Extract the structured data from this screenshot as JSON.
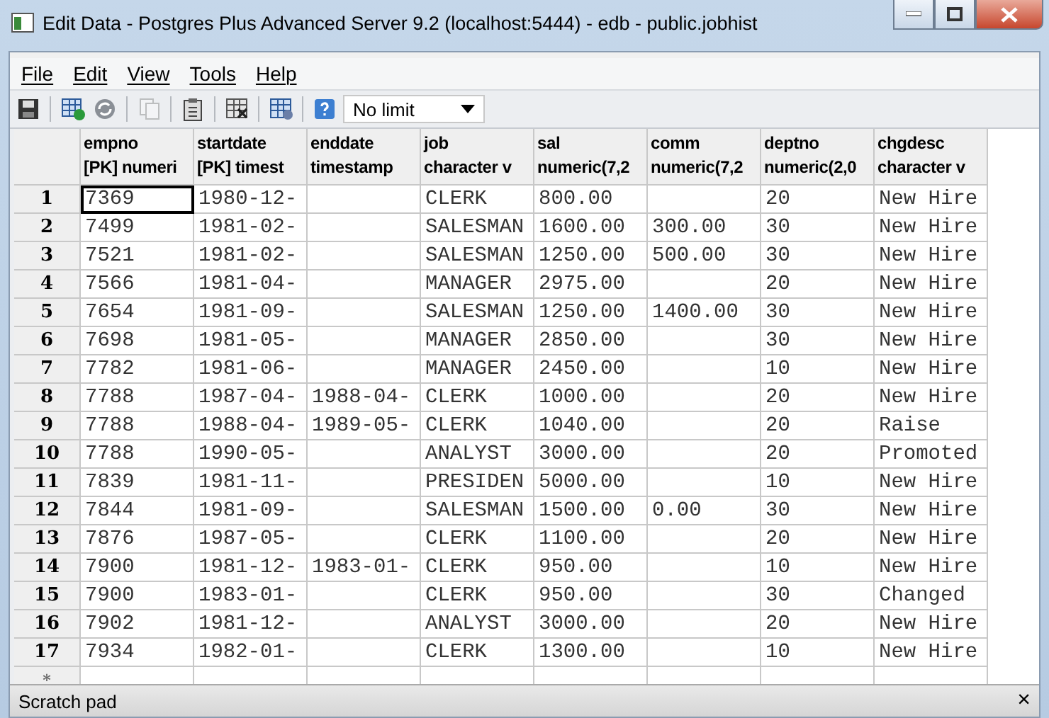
{
  "window": {
    "title": "Edit Data - Postgres Plus Advanced Server 9.2 (localhost:5444) - edb - public.jobhist"
  },
  "menu": [
    "File",
    "Edit",
    "View",
    "Tools",
    "Help"
  ],
  "toolbar": {
    "limit": "No limit",
    "buttons": [
      {
        "kind": "save",
        "disabled": false
      },
      {
        "kind": "sep"
      },
      {
        "kind": "add",
        "disabled": false
      },
      {
        "kind": "refresh",
        "disabled": false
      },
      {
        "kind": "sep"
      },
      {
        "kind": "copy",
        "disabled": true
      },
      {
        "kind": "sep"
      },
      {
        "kind": "paste",
        "disabled": false
      },
      {
        "kind": "sep"
      },
      {
        "kind": "delete",
        "disabled": false
      },
      {
        "kind": "sep"
      },
      {
        "kind": "filter",
        "disabled": false
      },
      {
        "kind": "sep"
      },
      {
        "kind": "help",
        "disabled": false
      }
    ]
  },
  "table": {
    "columns": [
      {
        "name": "empno",
        "type": "[PK] numeri"
      },
      {
        "name": "startdate",
        "type": "[PK] timest"
      },
      {
        "name": "enddate",
        "type": "timestamp"
      },
      {
        "name": "job",
        "type": "character v"
      },
      {
        "name": "sal",
        "type": "numeric(7,2"
      },
      {
        "name": "comm",
        "type": "numeric(7,2"
      },
      {
        "name": "deptno",
        "type": "numeric(2,0"
      },
      {
        "name": "chgdesc",
        "type": "character v"
      }
    ],
    "rows": [
      {
        "number": "1",
        "focused": true,
        "cells": [
          "7369",
          "1980-12-",
          null,
          "CLERK",
          "800.00",
          null,
          "20",
          "New Hire"
        ]
      },
      {
        "number": "2",
        "focused": false,
        "cells": [
          "7499",
          "1981-02-",
          null,
          "SALESMAN",
          "1600.00",
          "300.00",
          "30",
          "New Hire"
        ]
      },
      {
        "number": "3",
        "focused": false,
        "cells": [
          "7521",
          "1981-02-",
          null,
          "SALESMAN",
          "1250.00",
          "500.00",
          "30",
          "New Hire"
        ]
      },
      {
        "number": "4",
        "focused": false,
        "cells": [
          "7566",
          "1981-04-",
          null,
          "MANAGER",
          "2975.00",
          null,
          "20",
          "New Hire"
        ]
      },
      {
        "number": "5",
        "focused": false,
        "cells": [
          "7654",
          "1981-09-",
          null,
          "SALESMAN",
          "1250.00",
          "1400.00",
          "30",
          "New Hire"
        ]
      },
      {
        "number": "6",
        "focused": false,
        "cells": [
          "7698",
          "1981-05-",
          null,
          "MANAGER",
          "2850.00",
          null,
          "30",
          "New Hire"
        ]
      },
      {
        "number": "7",
        "focused": false,
        "cells": [
          "7782",
          "1981-06-",
          null,
          "MANAGER",
          "2450.00",
          null,
          "10",
          "New Hire"
        ]
      },
      {
        "number": "8",
        "focused": false,
        "cells": [
          "7788",
          "1987-04-",
          "1988-04-",
          "CLERK",
          "1000.00",
          null,
          "20",
          "New Hire"
        ]
      },
      {
        "number": "9",
        "focused": false,
        "cells": [
          "7788",
          "1988-04-",
          "1989-05-",
          "CLERK",
          "1040.00",
          null,
          "20",
          "Raise"
        ]
      },
      {
        "number": "10",
        "focused": false,
        "cells": [
          "7788",
          "1990-05-",
          null,
          "ANALYST",
          "3000.00",
          null,
          "20",
          "Promoted"
        ]
      },
      {
        "number": "11",
        "focused": false,
        "cells": [
          "7839",
          "1981-11-",
          null,
          "PRESIDEN",
          "5000.00",
          null,
          "10",
          "New Hire"
        ]
      },
      {
        "number": "12",
        "focused": false,
        "cells": [
          "7844",
          "1981-09-",
          null,
          "SALESMAN",
          "1500.00",
          "0.00",
          "30",
          "New Hire"
        ]
      },
      {
        "number": "13",
        "focused": false,
        "cells": [
          "7876",
          "1987-05-",
          null,
          "CLERK",
          "1100.00",
          null,
          "20",
          "New Hire"
        ]
      },
      {
        "number": "14",
        "focused": false,
        "cells": [
          "7900",
          "1981-12-",
          "1983-01-",
          "CLERK",
          "950.00",
          null,
          "10",
          "New Hire"
        ]
      },
      {
        "number": "15",
        "focused": false,
        "cells": [
          "7900",
          "1983-01-",
          null,
          "CLERK",
          "950.00",
          null,
          "30",
          "Changed"
        ]
      },
      {
        "number": "16",
        "focused": false,
        "cells": [
          "7902",
          "1981-12-",
          null,
          "ANALYST",
          "3000.00",
          null,
          "20",
          "New Hire"
        ]
      },
      {
        "number": "17",
        "focused": false,
        "cells": [
          "7934",
          "1982-01-",
          null,
          "CLERK",
          "1300.00",
          null,
          "10",
          "New Hire"
        ]
      }
    ],
    "new_row": "*"
  },
  "scratch_pad": {
    "label": "Scratch pad",
    "close": "×"
  }
}
